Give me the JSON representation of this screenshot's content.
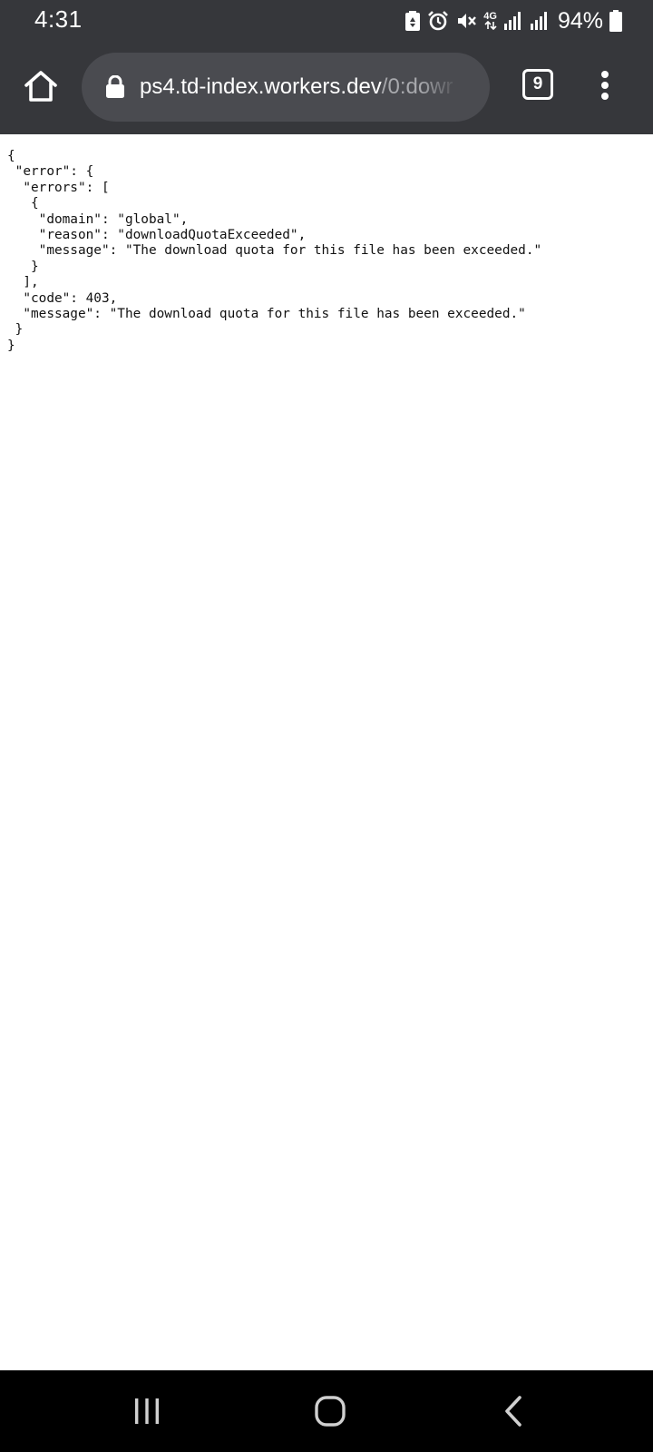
{
  "status_bar": {
    "time": "4:31",
    "network_type": "4G",
    "battery_percent": "94%",
    "icons": [
      "recycle-battery-icon",
      "alarm-icon",
      "vibrate-mute-icon",
      "network-4g-icon",
      "signal-icon",
      "signal-icon",
      "battery-icon"
    ]
  },
  "browser": {
    "url_host": "ps4.td-index.workers.dev",
    "url_path": "/0:dowr",
    "tab_count": "9"
  },
  "page": {
    "json_lines": [
      "{",
      " \"error\": {",
      "  \"errors\": [",
      "   {",
      "    \"domain\": \"global\",",
      "    \"reason\": \"downloadQuotaExceeded\",",
      "    \"message\": \"The download quota for this file has been exceeded.\"",
      "   }",
      "  ],",
      "  \"code\": 403,",
      "  \"message\": \"The download quota for this file has been exceeded.\"",
      " }",
      "}"
    ]
  },
  "colors": {
    "chrome": "#36373b",
    "omnibox": "#4a4b50",
    "url_path": "#a8a9ad",
    "navbar": "#000000"
  }
}
